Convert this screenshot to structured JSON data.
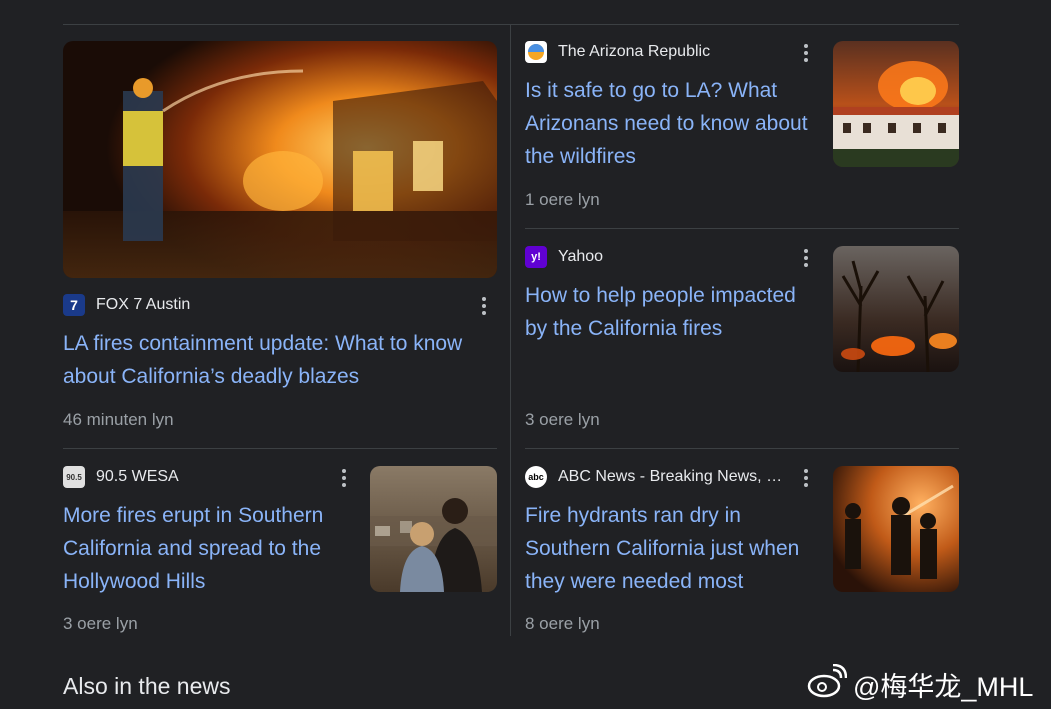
{
  "articles": [
    {
      "source": "FOX 7 Austin",
      "headline": "LA fires containment update: What to know about California’s deadly blazes",
      "time": "46 minuten lyn",
      "favicon_icon": "fox7-logo-icon",
      "favicon_text": "7",
      "favicon_color": "#1a3a8a",
      "image_desc": "firefighter-with-hose-burning-building"
    },
    {
      "source": "The Arizona Republic",
      "headline": "Is it safe to go to LA? What Arizonans need to know about the wildfires",
      "time": "1 oere lyn",
      "favicon_icon": "arizona-republic-logo-icon",
      "favicon_color": "#f5a623"
    },
    {
      "source": "Yahoo",
      "headline": "How to help people impacted by the California fires",
      "time": "3 oere lyn",
      "favicon_icon": "yahoo-logo-icon",
      "favicon_text": "y!",
      "favicon_color": "#6001d2"
    },
    {
      "source": "90.5 WESA",
      "headline": "More fires erupt in Southern California and spread to the Hollywood Hills",
      "time": "3 oere lyn",
      "favicon_icon": "wesa-logo-icon",
      "favicon_text": "90.5",
      "favicon_color": "#e0e0e0"
    },
    {
      "source": "ABC News - Breaking News, …",
      "headline": "Fire hydrants ran dry in Southern California just when they were needed most",
      "time": "8 oere lyn",
      "favicon_icon": "abc-news-logo-icon",
      "favicon_text": "abc",
      "favicon_color": "#ffffff"
    }
  ],
  "also_in_news": "Also in the news",
  "watermark": "@梅华龙_MHL",
  "more_options_icon": "more-vert-icon"
}
